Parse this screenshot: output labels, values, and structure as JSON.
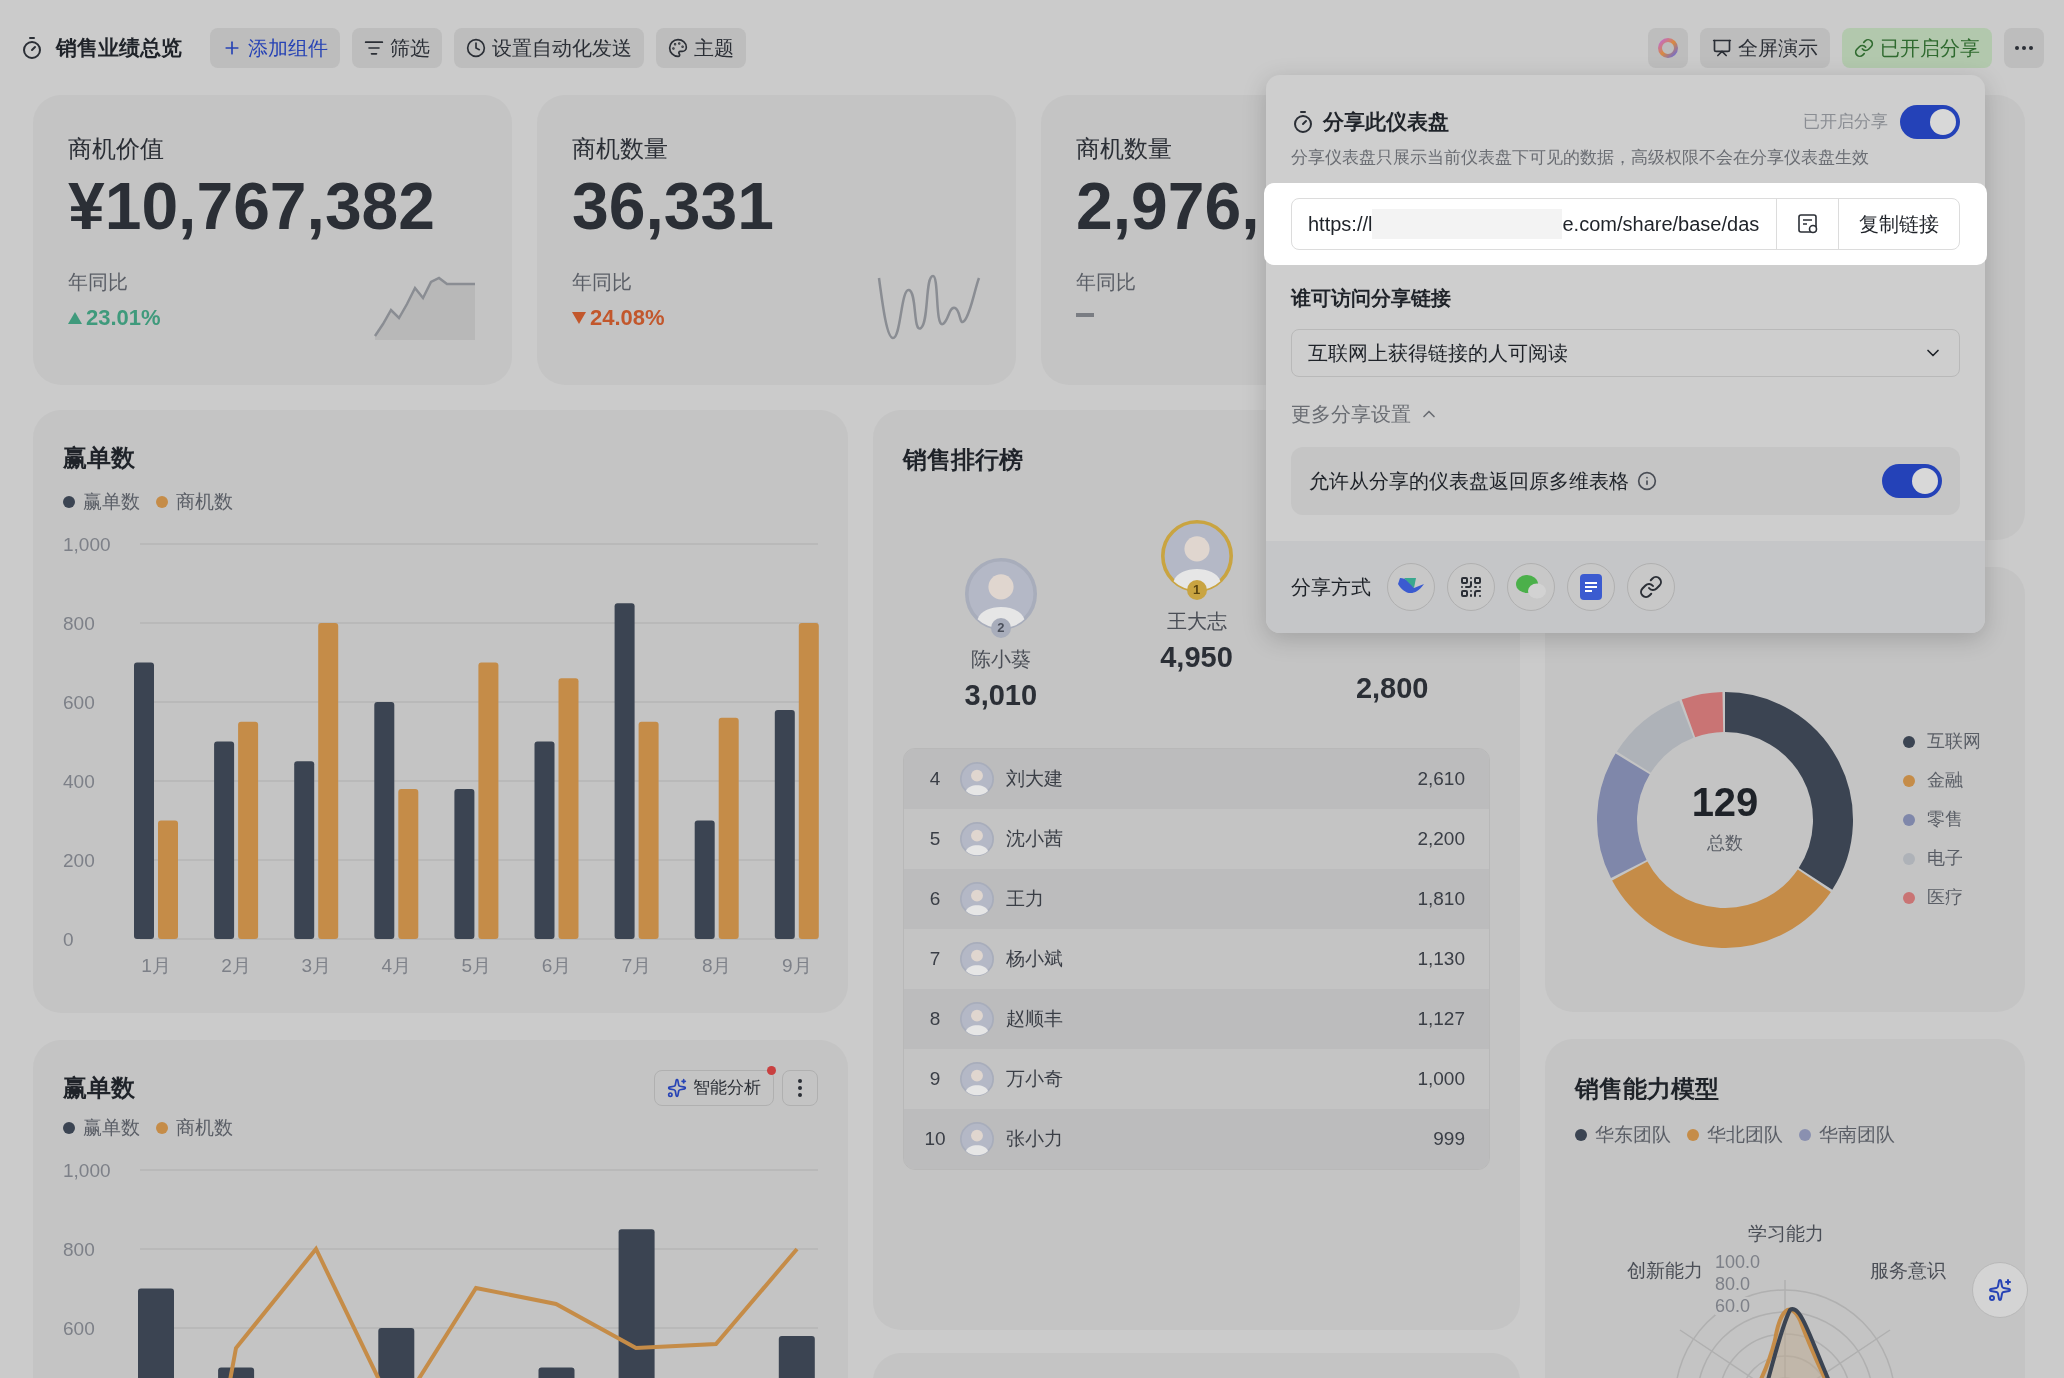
{
  "topbar": {
    "title": "销售业绩总览",
    "buttons": [
      {
        "kind": "add",
        "label": "添加组件"
      },
      {
        "kind": "filter",
        "label": "筛选"
      },
      {
        "kind": "automation",
        "label": "设置自动化发送"
      },
      {
        "kind": "theme",
        "label": "主题"
      }
    ],
    "right_buttons": [
      {
        "kind": "present",
        "label": "全屏演示"
      },
      {
        "kind": "share",
        "label": "已开启分享"
      }
    ]
  },
  "kpis": [
    {
      "kind": "rising",
      "title": "商机价值",
      "value": "¥10,767,382",
      "compare_label": "年同比",
      "change": "23.01%"
    },
    {
      "kind": "falling",
      "title": "商机数量",
      "value": "36,331",
      "compare_label": "年同比",
      "change": "24.08%"
    },
    {
      "kind": "flat",
      "title": "商机数量",
      "value": "2,976,",
      "compare_label": "年同比"
    }
  ],
  "win_chart": {
    "title": "赢单数",
    "chart_data": {
      "type": "bar",
      "stacked": false,
      "grid": true,
      "categories": [
        "1月",
        "2月",
        "3月",
        "4月",
        "5月",
        "6月",
        "7月",
        "8月",
        "9月"
      ],
      "ylim": [
        0,
        1000
      ],
      "yticks": [
        {
          "value": 0,
          "label": "0"
        },
        {
          "value": 200,
          "label": "200"
        },
        {
          "value": 400,
          "label": "400"
        },
        {
          "value": 600,
          "label": "600"
        },
        {
          "value": 800,
          "label": "800"
        },
        {
          "value": 1000,
          "label": "1,000"
        }
      ],
      "series": [
        {
          "name": "赢单数",
          "color": "#3b4452",
          "values": [
            700,
            500,
            450,
            600,
            380,
            500,
            850,
            300,
            580
          ]
        },
        {
          "name": "商机数",
          "color": "#c58c48",
          "values": [
            300,
            550,
            800,
            380,
            700,
            660,
            550,
            560,
            800
          ]
        }
      ]
    }
  },
  "combo_chart": {
    "title": "赢单数",
    "ai_button": "智能分析",
    "ai_notice": true,
    "legend": [
      {
        "label": "赢单数",
        "color": "#3b4452"
      },
      {
        "label": "商机数",
        "color": "#c58c48"
      }
    ],
    "axis_labels": [
      "1,000",
      "800",
      "600"
    ]
  },
  "ranking": {
    "title": "销售排行榜",
    "podium": [
      {
        "rank": "2",
        "name": "陈小葵",
        "score": "3,010"
      },
      {
        "rank": "1",
        "name": "王大志",
        "score": "4,950"
      },
      {
        "score": "2,800"
      }
    ],
    "list": [
      {
        "rank": "4",
        "name": "刘大建",
        "score": "2,610"
      },
      {
        "rank": "5",
        "name": "沈小茜",
        "score": "2,200"
      },
      {
        "rank": "6",
        "name": "王力",
        "score": "1,810"
      },
      {
        "rank": "7",
        "name": "杨小斌",
        "score": "1,130"
      },
      {
        "rank": "8",
        "name": "赵顺丰",
        "score": "1,127"
      },
      {
        "rank": "9",
        "name": "万小奇",
        "score": "1,000"
      },
      {
        "rank": "10",
        "name": "张小力",
        "score": "999"
      }
    ]
  },
  "industry": {
    "total": "129",
    "total_label": "总数",
    "legend": [
      {
        "label": "互联网",
        "color": "#3b4452"
      },
      {
        "label": "金融",
        "color": "#c58c48"
      },
      {
        "label": "零售",
        "color": "#7f87aa"
      },
      {
        "label": "电子",
        "color": "#aeb2b8"
      },
      {
        "label": "医疗",
        "color": "#c97474"
      }
    ]
  },
  "radar": {
    "title": "销售能力模型",
    "legend": [
      {
        "label": "华东团队",
        "color": "#3b4452"
      },
      {
        "label": "华北团队",
        "color": "#c58c48"
      },
      {
        "label": "华南团队",
        "color": "#8a90b0"
      }
    ],
    "axes": [
      "学习能力",
      "创新能力",
      "服务意识"
    ],
    "ticks": [
      "100.0",
      "80.0",
      "60.0"
    ]
  },
  "share_popover": {
    "title": "分享此仪表盘",
    "status_label": "已开启分享",
    "enabled": true,
    "description": "分享仪表盘只展示当前仪表盘下可见的数据，高级权限不会在分享仪表盘生效",
    "url_start": "https://l",
    "url_end": "e.com/share/base/das",
    "copy_button": "复制链接",
    "access_heading": "谁可访问分享链接",
    "access_value": "互联网上获得链接的人可阅读",
    "more_settings": "更多分享设置",
    "more_expanded": true,
    "allow_return_label": "允许从分享的仪表盘返回原多维表格",
    "allow_return": true,
    "methods_label": "分享方式",
    "methods": [
      {
        "kind": "app"
      },
      {
        "kind": "qrcode"
      },
      {
        "kind": "wechat"
      },
      {
        "kind": "doc"
      },
      {
        "kind": "link"
      }
    ]
  }
}
